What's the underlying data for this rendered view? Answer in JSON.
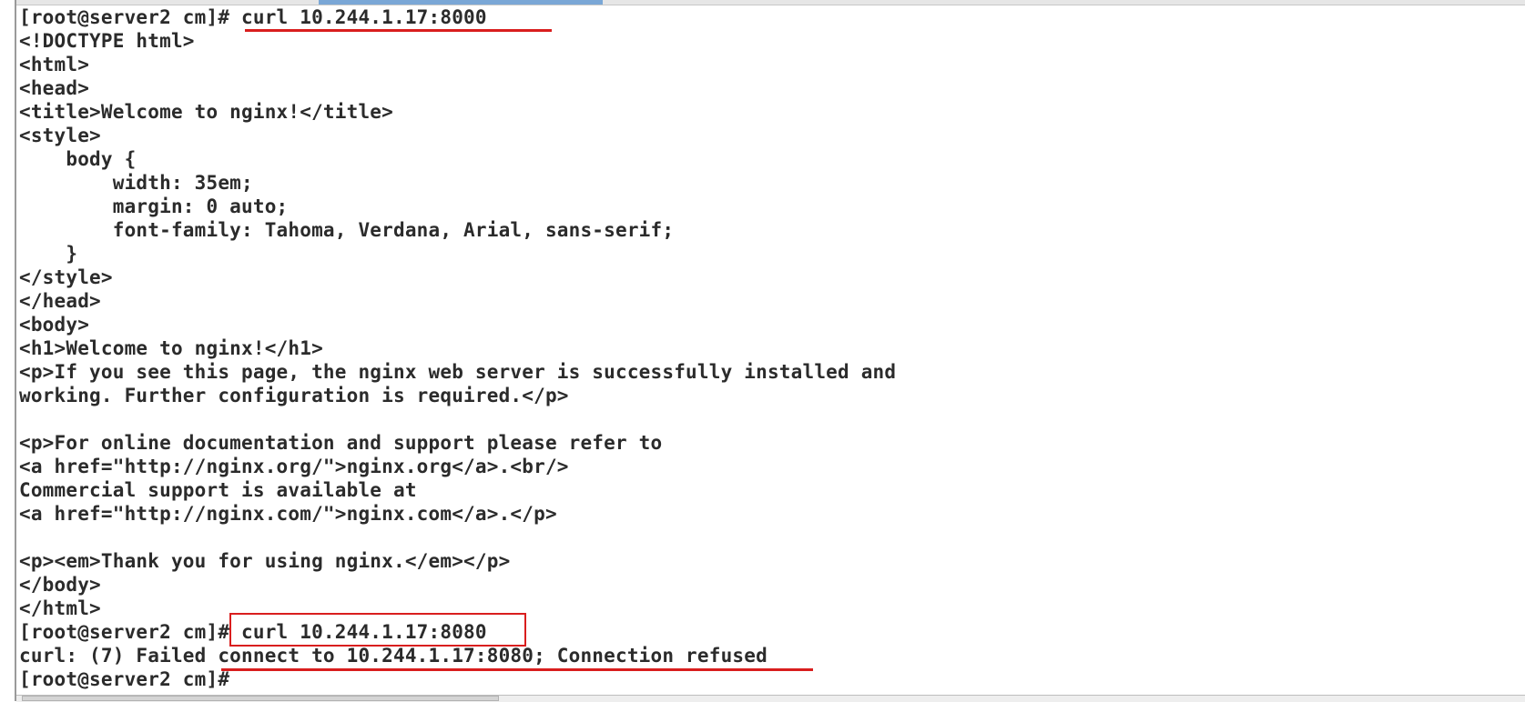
{
  "terminal": {
    "lines": [
      "[root@server2 cm]# curl 10.244.1.17:8000",
      "<!DOCTYPE html>",
      "<html>",
      "<head>",
      "<title>Welcome to nginx!</title>",
      "<style>",
      "    body {",
      "        width: 35em;",
      "        margin: 0 auto;",
      "        font-family: Tahoma, Verdana, Arial, sans-serif;",
      "    }",
      "</style>",
      "</head>",
      "<body>",
      "<h1>Welcome to nginx!</h1>",
      "<p>If you see this page, the nginx web server is successfully installed and",
      "working. Further configuration is required.</p>",
      "",
      "<p>For online documentation and support please refer to",
      "<a href=\"http://nginx.org/\">nginx.org</a>.<br/>",
      "Commercial support is available at",
      "<a href=\"http://nginx.com/\">nginx.com</a>.</p>",
      "",
      "<p><em>Thank you for using nginx.</em></p>",
      "</body>",
      "</html>",
      "[root@server2 cm]# curl 10.244.1.17:8080",
      "curl: (7) Failed connect to 10.244.1.17:8080; Connection refused",
      "[root@server2 cm]#"
    ]
  },
  "colors": {
    "text": "#2b2b2b",
    "background": "#ffffff",
    "annotation": "#d91e1e"
  }
}
